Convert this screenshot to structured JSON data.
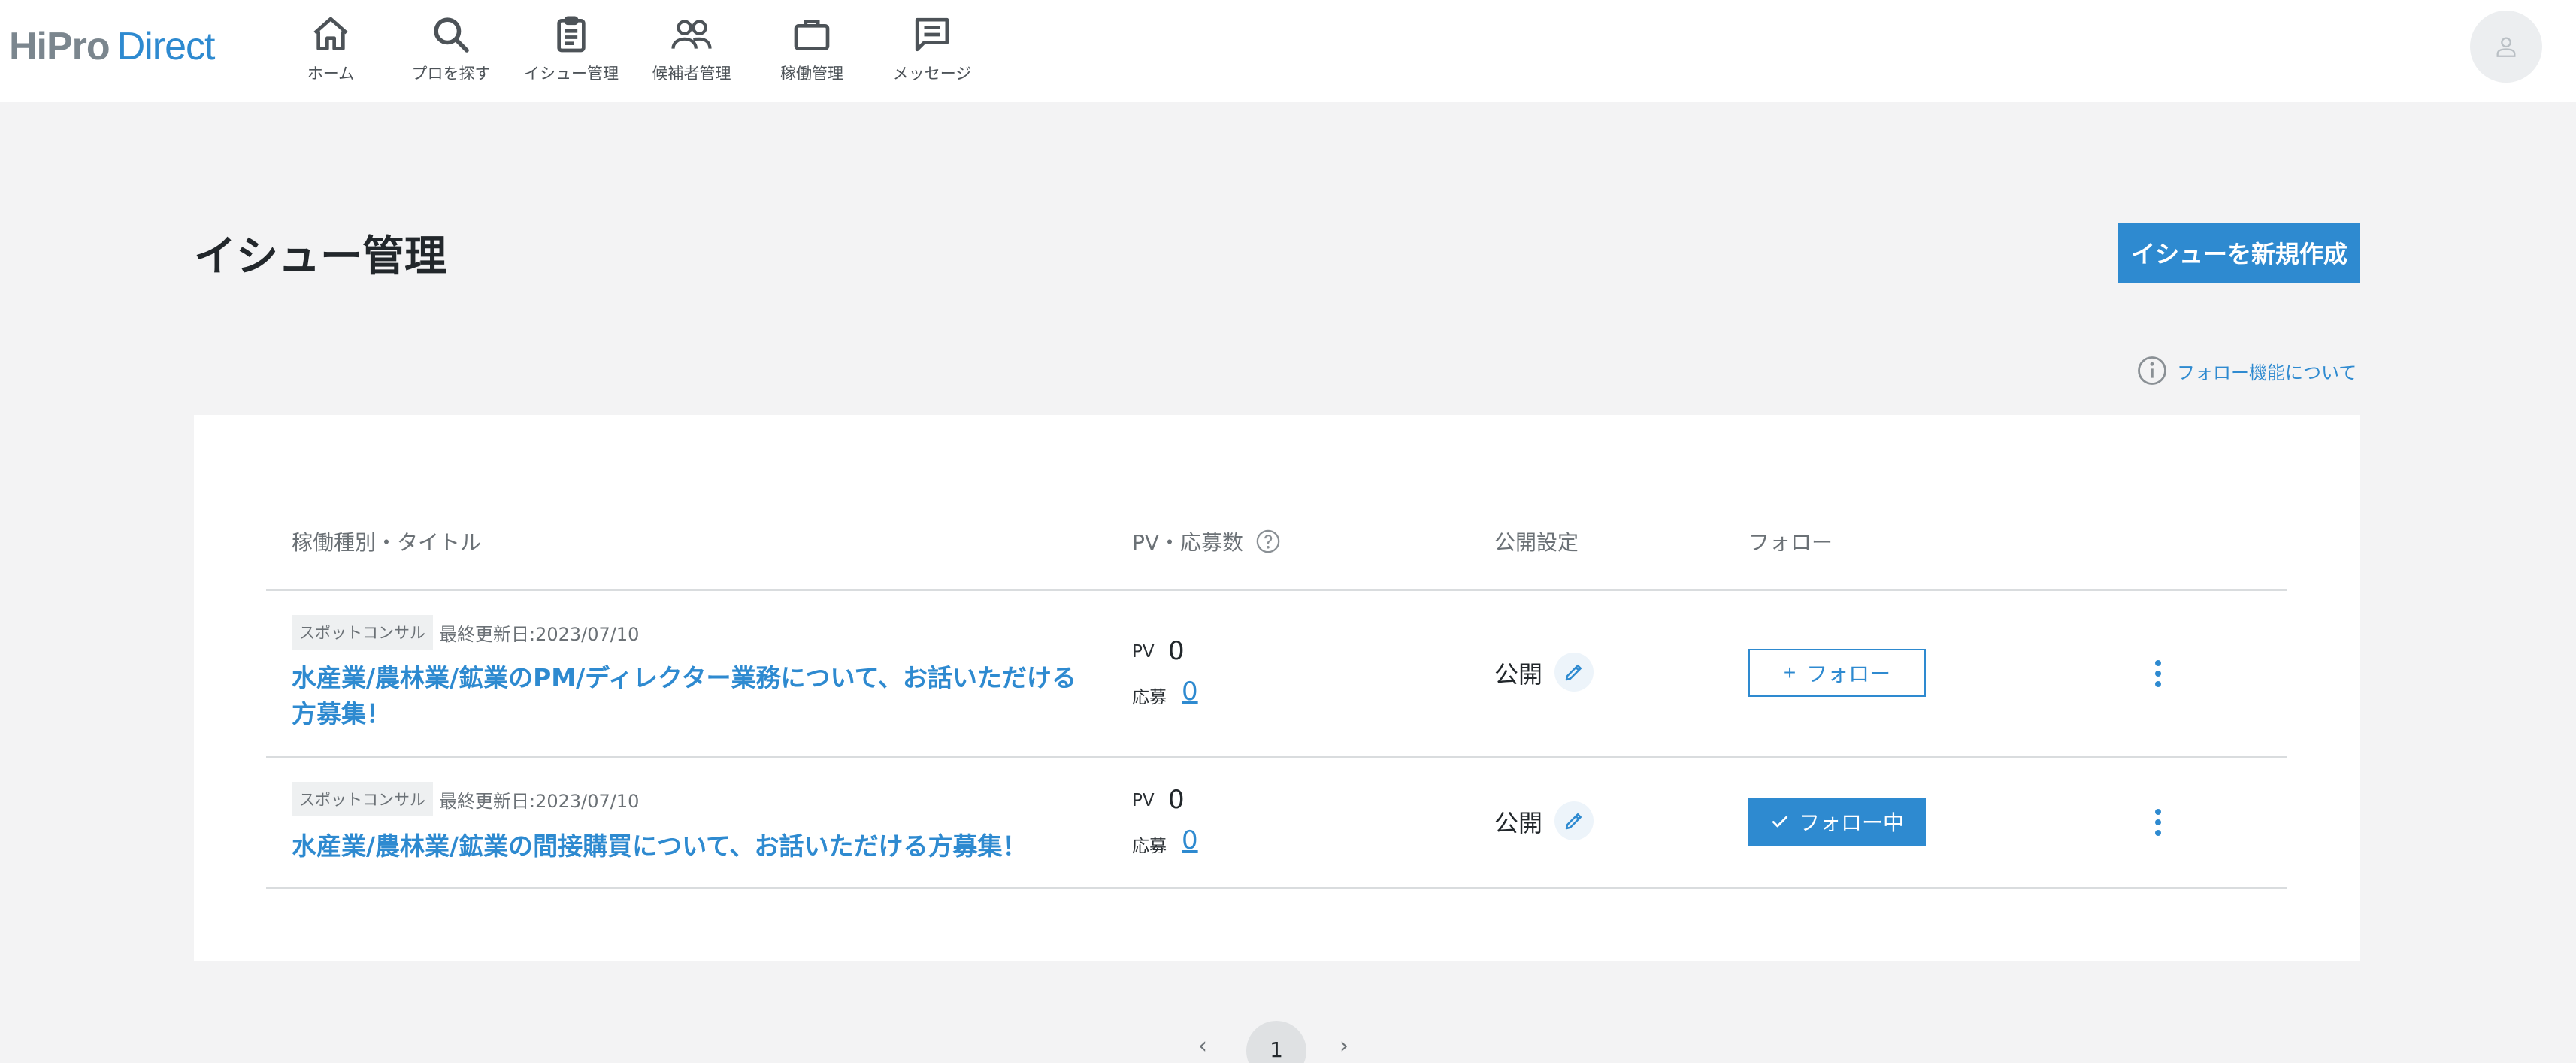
{
  "header": {
    "logo_hipro": "HiPro",
    "logo_direct": "Direct",
    "nav": [
      {
        "label": "ホーム",
        "icon": "home-icon"
      },
      {
        "label": "プロを探す",
        "icon": "search-icon"
      },
      {
        "label": "イシュー管理",
        "icon": "clipboard-icon"
      },
      {
        "label": "候補者管理",
        "icon": "people-icon"
      },
      {
        "label": "稼働管理",
        "icon": "briefcase-icon"
      },
      {
        "label": "メッセージ",
        "icon": "message-icon"
      }
    ]
  },
  "page": {
    "title": "イシュー管理",
    "new_issue_label": "イシューを新規作成",
    "follow_info_label": "フォロー機能について"
  },
  "table": {
    "headers": {
      "title": "稼働種別・タイトル",
      "pv": "PV・応募数",
      "visibility": "公開設定",
      "follow": "フォロー"
    },
    "rows": [
      {
        "tag": "スポットコンサル",
        "updated": "最終更新日:2023/07/10",
        "title": "水産業/農林業/鉱業のPM/ディレクター業務について、お話いただける方募集！",
        "pv_label": "PV",
        "pv": "0",
        "apply_label": "応募",
        "applications": "0",
        "visibility": "公開",
        "follow_label": "フォロー",
        "following": false
      },
      {
        "tag": "スポットコンサル",
        "updated": "最終更新日:2023/07/10",
        "title": "水産業/農林業/鉱業の間接購買について、お話いただける方募集！",
        "pv_label": "PV",
        "pv": "0",
        "apply_label": "応募",
        "applications": "0",
        "visibility": "公開",
        "follow_label": "フォロー中",
        "following": true
      }
    ]
  },
  "pagination": {
    "prev": "‹",
    "current": "1",
    "next": "›"
  },
  "colors": {
    "accent": "#2e8ad0",
    "background": "#f3f3f4",
    "tag_bg": "#eef0f1"
  }
}
